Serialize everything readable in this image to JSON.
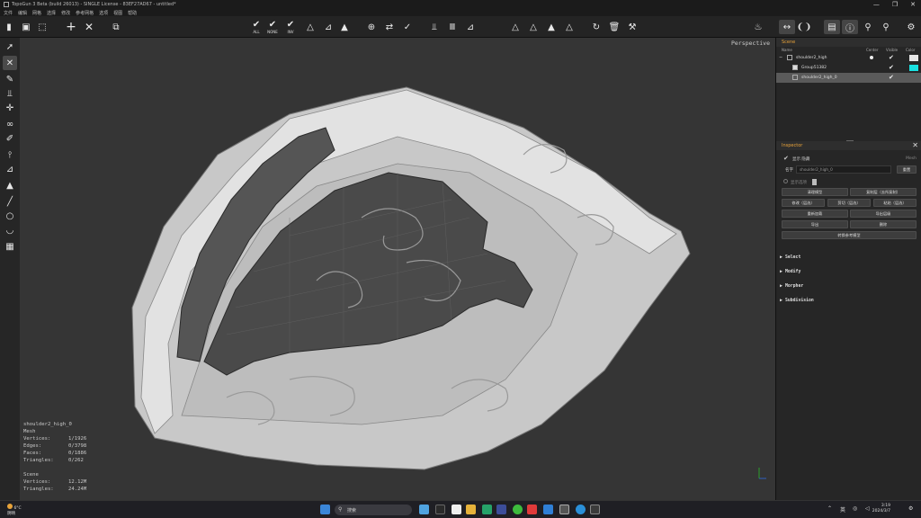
{
  "window": {
    "title": "TopoGun 3 Beta (build 26013) - SINGLE License - 83EF27AD67 - untitled*",
    "controls": [
      "—",
      "❐",
      "✕"
    ]
  },
  "menu": [
    "文件",
    "编辑",
    "网格",
    "选择",
    "修改",
    "参考网格",
    "选项",
    "视图",
    "帮助"
  ],
  "toolbar": {
    "all": "ALL",
    "none": "NONE",
    "inv": "INV"
  },
  "viewport": {
    "label": "Perspective",
    "stats": {
      "object": "shoulder2_high_0",
      "mesh_label": "Mesh",
      "rows": [
        {
          "k": "Vertices:",
          "v": "1/1926"
        },
        {
          "k": "Edges:",
          "v": "0/3798"
        },
        {
          "k": "Faces:",
          "v": "0/1886"
        },
        {
          "k": "Triangles:",
          "v": "0/262"
        }
      ],
      "scene_label": "Scene",
      "scene_rows": [
        {
          "k": "Vertices:",
          "v": "12.12M"
        },
        {
          "k": "Triangles:",
          "v": "24.24M"
        }
      ]
    }
  },
  "scene_panel": {
    "title": "Scene",
    "columns": {
      "name": "Name",
      "center": "Center",
      "visible": "Visible",
      "color": "Color"
    },
    "rows": [
      {
        "name": "shoulder2_high",
        "color": "#e6e6e6",
        "selected": false
      },
      {
        "name": "Group51382",
        "color": "#19e0e0",
        "selected": false
      },
      {
        "name": "shoulder2_high_0",
        "color": "",
        "selected": true
      }
    ]
  },
  "inspector": {
    "title": "Inspector",
    "show_label": "显示 隐藏",
    "mesh_tag": "Mesh",
    "name_label": "名字",
    "name_value": "shoulder2_high_0",
    "rename_button": "重置",
    "opacity_label": "显示选项",
    "buttons": [
      [
        "清理模型",
        "复制层（去所复制）"
      ],
      [
        "修改（层选）",
        "剪切（层选）",
        "粘贴（层选）"
      ],
      [
        "重新加载",
        "导出层级"
      ],
      [
        "导出",
        "删除"
      ],
      [
        "转换参考模型"
      ]
    ],
    "sections": [
      "Select",
      "Modify",
      "Morpher",
      "Subdivision"
    ]
  },
  "taskbar": {
    "weather_temp": "6°C",
    "weather_text": "阴晴",
    "search_placeholder": "搜索",
    "ime": "英",
    "time": "3:19",
    "date": "2024/3/7"
  },
  "colors": {
    "accent": "#e8a33a",
    "cyan": "#19e0e0",
    "viewport_bg": "#353535"
  }
}
